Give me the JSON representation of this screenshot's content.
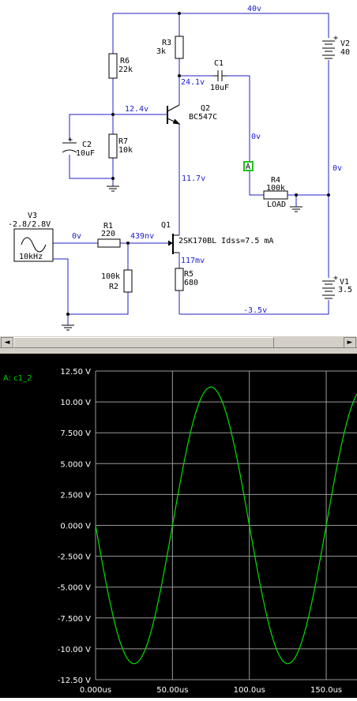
{
  "colors": {
    "wire": "#2020c8",
    "node_label": "#1a1ad0",
    "component": "#000000",
    "wave": "#00e000",
    "grid": "#9a9a9a",
    "scope_text": "#ffffff",
    "trace_name": "#00d000"
  },
  "schematic": {
    "node_labels": {
      "v40": "40v",
      "v24": "24.1v",
      "v12": "12.4v",
      "v11": "11.7v",
      "v0_c1": "0v",
      "v0_right": "0v",
      "v0_in": "0v",
      "v439": "439nv",
      "v117": "117mv",
      "vneg35": "-3.5v"
    },
    "components": {
      "r3": {
        "name": "R3",
        "value": "3k"
      },
      "r6": {
        "name": "R6",
        "value": "22k"
      },
      "r7": {
        "name": "R7",
        "value": "10k"
      },
      "c1": {
        "name": "C1",
        "value": "10uF"
      },
      "c2": {
        "name": "C2",
        "value": "10uF"
      },
      "q2": {
        "name": "Q2",
        "value": "BC547C"
      },
      "q1": {
        "name": "Q1",
        "value": "2SK170BL Idss=7.5 mA"
      },
      "r4": {
        "name": "R4",
        "value": "100k",
        "extra": "LOAD"
      },
      "v2": {
        "name": "V2",
        "value": "40"
      },
      "v1": {
        "name": "V1",
        "value": "3.5"
      },
      "v3": {
        "name": "V3",
        "value": "-2.8/2.8V",
        "freq": "10kHz"
      },
      "r1": {
        "name": "R1",
        "value": "220"
      },
      "r2": {
        "name": "R2",
        "value": "100k"
      },
      "r5": {
        "name": "R5",
        "value": "680"
      }
    },
    "probe": "A"
  },
  "scrollbar": {
    "left_arrow": "◄",
    "right_arrow": "►"
  },
  "scope": {
    "trace_label": "A: c1_2",
    "y_ticks": [
      "12.50 V",
      "10.00 V",
      "7.500 V",
      "5.000 V",
      "2.500 V",
      "0.000 V",
      "-2.500 V",
      "-5.000 V",
      "-7.500 V",
      "-10.00 V",
      "-12.50 V"
    ],
    "x_ticks": [
      "0.000us",
      "50.00us",
      "100.0us",
      "150.0us"
    ]
  },
  "chart_data": {
    "type": "line",
    "title": "",
    "xlabel": "",
    "ylabel": "",
    "xlim": [
      0,
      170
    ],
    "ylim": [
      -12.5,
      12.5
    ],
    "x_unit": "us",
    "y_unit": "V",
    "grid": true,
    "series": [
      {
        "name": "A: c1_2",
        "waveform": "sine",
        "amplitude": 11.2,
        "period_us": 100,
        "phase": "inverted",
        "x": [
          0,
          12.5,
          25,
          37.5,
          50,
          62.5,
          75,
          87.5,
          100,
          112.5,
          125,
          137.5,
          150,
          162.5,
          170
        ],
        "values": [
          0,
          -7.9,
          -11.2,
          -7.9,
          0,
          7.9,
          11.2,
          7.9,
          0,
          -7.9,
          -11.2,
          -7.9,
          0,
          7.9,
          10.7
        ]
      }
    ]
  }
}
